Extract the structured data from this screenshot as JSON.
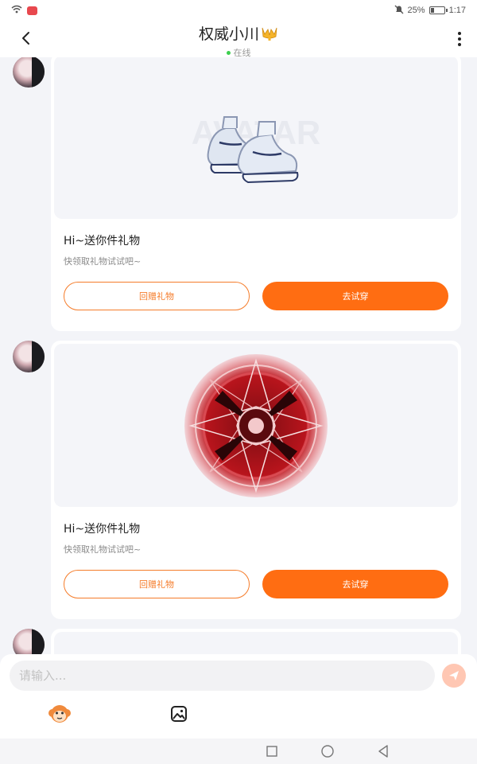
{
  "status_bar": {
    "battery_text": "25%",
    "time": "1:17"
  },
  "header": {
    "title": "权威小川",
    "status": "在线"
  },
  "messages": [
    {
      "gift_icon": "sneakers-icon",
      "watermark": "AVATAR",
      "title": "Hi~送你件礼物",
      "desc": "快领取礼物试试吧~",
      "return_label": "回赠礼物",
      "try_label": "去试穿"
    },
    {
      "gift_icon": "red-magic-circle-icon",
      "title": "Hi~送你件礼物",
      "desc": "快领取礼物试试吧~",
      "return_label": "回赠礼物",
      "try_label": "去试穿"
    }
  ],
  "input": {
    "placeholder": "请输入..."
  },
  "colors": {
    "accent": "#ff6d12",
    "outline": "#f57c2a",
    "online": "#3ccf4e",
    "send_disabled": "#ffc7b3"
  }
}
